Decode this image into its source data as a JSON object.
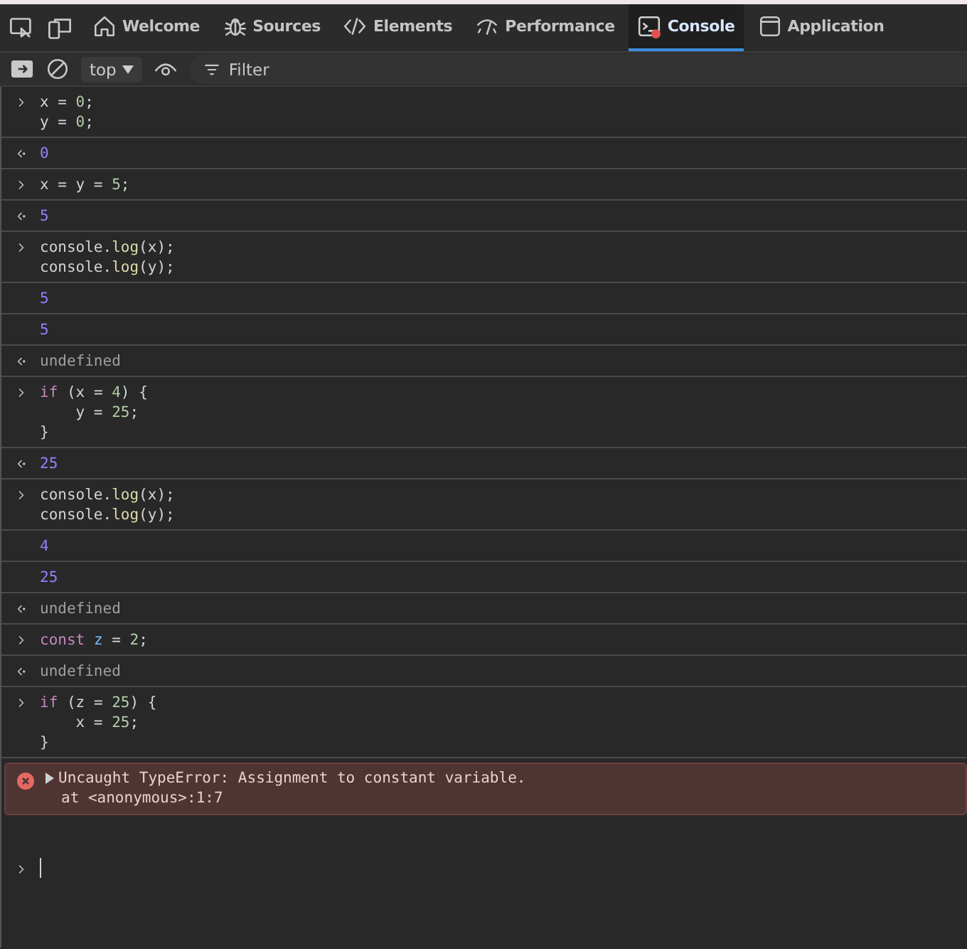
{
  "tabs": [
    {
      "label": "Welcome",
      "selected": false
    },
    {
      "label": "Sources",
      "selected": false
    },
    {
      "label": "Elements",
      "selected": false
    },
    {
      "label": "Performance",
      "selected": false
    },
    {
      "label": "Console",
      "selected": true
    },
    {
      "label": "Application",
      "selected": false
    }
  ],
  "toolbar": {
    "context": "top",
    "filter_placeholder": "Filter"
  },
  "entries": [
    {
      "kind": "input",
      "lines": [
        [
          {
            "text": "x = ",
            "kind": "plain"
          },
          {
            "text": "0",
            "kind": "number"
          },
          {
            "text": ";",
            "kind": "plain"
          }
        ],
        [
          {
            "text": "y = ",
            "kind": "plain"
          },
          {
            "text": "0",
            "kind": "number"
          },
          {
            "text": ";",
            "kind": "plain"
          }
        ]
      ]
    },
    {
      "kind": "result",
      "lines": [
        [
          {
            "text": "0",
            "kind": "value"
          }
        ]
      ]
    },
    {
      "kind": "input",
      "lines": [
        [
          {
            "text": "x = y = ",
            "kind": "plain"
          },
          {
            "text": "5",
            "kind": "number"
          },
          {
            "text": ";",
            "kind": "plain"
          }
        ]
      ]
    },
    {
      "kind": "result",
      "lines": [
        [
          {
            "text": "5",
            "kind": "value"
          }
        ]
      ]
    },
    {
      "kind": "input",
      "lines": [
        [
          {
            "text": "console.",
            "kind": "plain"
          },
          {
            "text": "log",
            "kind": "fn"
          },
          {
            "text": "(x);",
            "kind": "plain"
          }
        ],
        [
          {
            "text": "console.",
            "kind": "plain"
          },
          {
            "text": "log",
            "kind": "fn"
          },
          {
            "text": "(y);",
            "kind": "plain"
          }
        ]
      ]
    },
    {
      "kind": "log",
      "lines": [
        [
          {
            "text": "5",
            "kind": "value"
          }
        ]
      ]
    },
    {
      "kind": "log",
      "lines": [
        [
          {
            "text": "5",
            "kind": "value"
          }
        ]
      ]
    },
    {
      "kind": "result",
      "lines": [
        [
          {
            "text": "undefined",
            "kind": "undefined"
          }
        ]
      ]
    },
    {
      "kind": "input",
      "lines": [
        [
          {
            "text": "if",
            "kind": "keyword"
          },
          {
            "text": " (x = ",
            "kind": "plain"
          },
          {
            "text": "4",
            "kind": "number"
          },
          {
            "text": ") {",
            "kind": "plain"
          }
        ],
        [
          {
            "text": "    y = ",
            "kind": "plain"
          },
          {
            "text": "25",
            "kind": "number"
          },
          {
            "text": ";",
            "kind": "plain"
          }
        ],
        [
          {
            "text": "}",
            "kind": "plain"
          }
        ]
      ]
    },
    {
      "kind": "result",
      "lines": [
        [
          {
            "text": "25",
            "kind": "value"
          }
        ]
      ]
    },
    {
      "kind": "input",
      "lines": [
        [
          {
            "text": "console.",
            "kind": "plain"
          },
          {
            "text": "log",
            "kind": "fn"
          },
          {
            "text": "(x);",
            "kind": "plain"
          }
        ],
        [
          {
            "text": "console.",
            "kind": "plain"
          },
          {
            "text": "log",
            "kind": "fn"
          },
          {
            "text": "(y);",
            "kind": "plain"
          }
        ]
      ]
    },
    {
      "kind": "log",
      "lines": [
        [
          {
            "text": "4",
            "kind": "value"
          }
        ]
      ]
    },
    {
      "kind": "log",
      "lines": [
        [
          {
            "text": "25",
            "kind": "value"
          }
        ]
      ]
    },
    {
      "kind": "result",
      "lines": [
        [
          {
            "text": "undefined",
            "kind": "undefined"
          }
        ]
      ]
    },
    {
      "kind": "input",
      "lines": [
        [
          {
            "text": "const ",
            "kind": "keyword"
          },
          {
            "text": "z",
            "kind": "variable"
          },
          {
            "text": " = ",
            "kind": "plain"
          },
          {
            "text": "2",
            "kind": "number"
          },
          {
            "text": ";",
            "kind": "plain"
          }
        ]
      ]
    },
    {
      "kind": "result",
      "lines": [
        [
          {
            "text": "undefined",
            "kind": "undefined"
          }
        ]
      ]
    },
    {
      "kind": "input",
      "lines": [
        [
          {
            "text": "if",
            "kind": "keyword"
          },
          {
            "text": " (z = ",
            "kind": "plain"
          },
          {
            "text": "25",
            "kind": "number"
          },
          {
            "text": ") {",
            "kind": "plain"
          }
        ],
        [
          {
            "text": "    x = ",
            "kind": "plain"
          },
          {
            "text": "25",
            "kind": "number"
          },
          {
            "text": ";",
            "kind": "plain"
          }
        ],
        [
          {
            "text": "}",
            "kind": "plain"
          }
        ]
      ]
    },
    {
      "kind": "error",
      "expanded": false,
      "message": "Uncaught TypeError: Assignment to constant variable.",
      "trace": "at <anonymous>:1:7"
    }
  ]
}
